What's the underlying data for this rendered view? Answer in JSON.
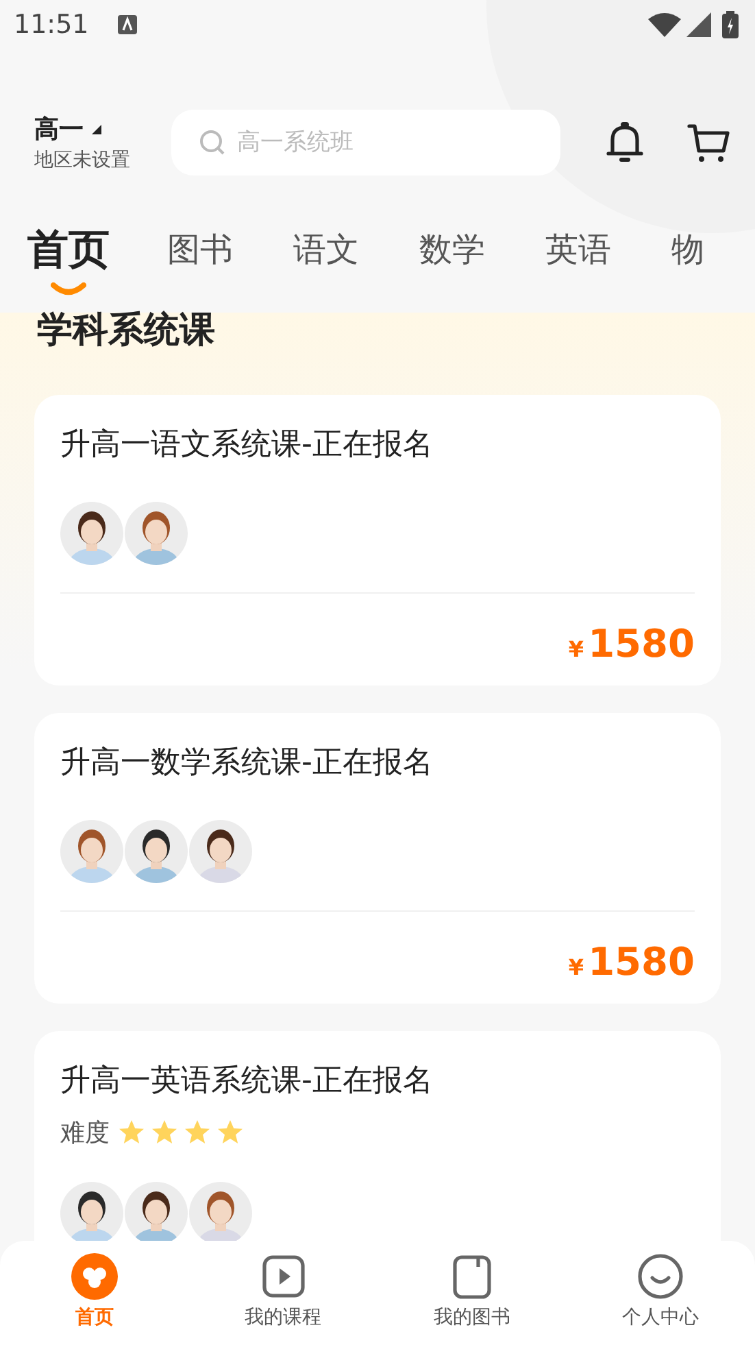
{
  "status_bar": {
    "time": "11:51"
  },
  "header": {
    "grade": "高一",
    "region": "地区未设置",
    "search": {
      "placeholder": "高一系统班"
    }
  },
  "tabs": [
    {
      "label": "首页",
      "selected": true
    },
    {
      "label": "图书",
      "selected": false
    },
    {
      "label": "语文",
      "selected": false
    },
    {
      "label": "数学",
      "selected": false
    },
    {
      "label": "英语",
      "selected": false
    },
    {
      "label": "物",
      "selected": false
    }
  ],
  "section": {
    "title": "学科系统课"
  },
  "courses": [
    {
      "title": "升高一语文系统课-正在报名",
      "currency": "¥",
      "price": "1580"
    },
    {
      "title": "升高一数学系统课-正在报名",
      "currency": "¥",
      "price": "1580"
    },
    {
      "title": "升高一英语系统课-正在报名",
      "difficulty": {
        "label": "难度",
        "stars": 4
      }
    }
  ],
  "bottom_nav": [
    {
      "label": "首页",
      "kind": "home",
      "selected": true
    },
    {
      "label": "我的课程",
      "kind": "courses",
      "selected": false
    },
    {
      "label": "我的图书",
      "kind": "books",
      "selected": false
    },
    {
      "label": "个人中心",
      "kind": "profile",
      "selected": false
    }
  ]
}
